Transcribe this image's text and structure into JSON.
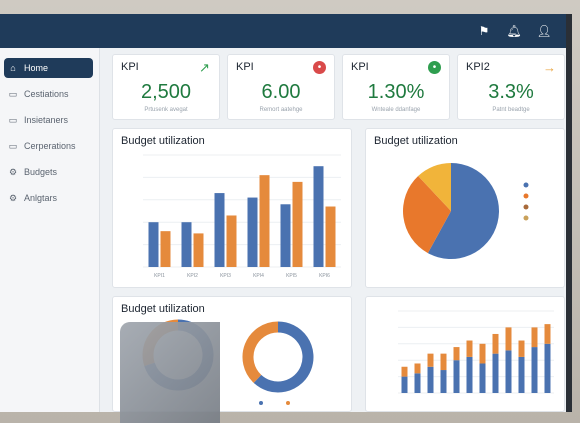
{
  "topbar": {
    "icons": [
      "flag-icon",
      "bell-icon",
      "user-icon"
    ]
  },
  "sidebar": {
    "items": [
      {
        "label": "Home",
        "icon": "home-icon",
        "active": true
      },
      {
        "label": "Cestiations",
        "icon": "doc-icon"
      },
      {
        "label": "Insietaners",
        "icon": "doc-icon"
      },
      {
        "label": "Cerperations",
        "icon": "doc-icon"
      },
      {
        "label": "Budgets",
        "icon": "gear-icon"
      },
      {
        "label": "Anlgtars",
        "icon": "gear-icon"
      }
    ]
  },
  "kpis": [
    {
      "label": "KPI",
      "value": "2,500",
      "sub": "Prtusenk avegat",
      "icon": "arrow-up-icon",
      "icon_color": "#2f9e4f"
    },
    {
      "label": "KPI",
      "value": "6.00",
      "sub": "Remort aatehge",
      "icon": "dot-icon",
      "icon_color": "#d94a4a"
    },
    {
      "label": "KPI",
      "value": "1.30%",
      "sub": "Wnteale ddanfage",
      "icon": "dot-icon",
      "icon_color": "#2f9e4f"
    },
    {
      "label": "KPI2",
      "value": "3.3%",
      "sub": "Patnt beadtge",
      "icon": "arrow-right-icon",
      "icon_color": "#e8a23a"
    }
  ],
  "budget_bar": {
    "title": "Budget utilization",
    "chart_data": {
      "type": "bar",
      "categories": [
        "KPI1",
        "KPI2",
        "KPI3",
        "KPI4",
        "KPI5",
        "KPI6"
      ],
      "series": [
        {
          "color": "#4a72b0",
          "values": [
            2.0,
            2.0,
            3.3,
            3.1,
            2.8,
            4.5
          ]
        },
        {
          "color": "#e58a3c",
          "values": [
            1.6,
            1.5,
            2.3,
            4.1,
            3.8,
            2.7
          ]
        }
      ],
      "ylim": [
        0,
        5
      ]
    }
  },
  "budget_pie": {
    "title": "Budget utilization",
    "chart_data": {
      "type": "pie",
      "slices": [
        {
          "value": 58,
          "color": "#4a72b0"
        },
        {
          "value": 30,
          "color": "#e8782c"
        },
        {
          "value": 12,
          "color": "#f1b43a"
        }
      ]
    }
  },
  "budget_donuts": {
    "title": "Budget utilization",
    "chart_data": {
      "type": "pie",
      "donuts": [
        {
          "slices": [
            {
              "value": 70,
              "color": "#4a72b0"
            },
            {
              "value": 30,
              "color": "#e58a3c"
            }
          ]
        },
        {
          "slices": [
            {
              "value": 62,
              "color": "#4a72b0"
            },
            {
              "value": 38,
              "color": "#e58a3c"
            }
          ]
        }
      ]
    }
  },
  "stacked_bar": {
    "chart_data": {
      "type": "bar",
      "stacked": true,
      "ylim": [
        0,
        25
      ],
      "series": [
        {
          "color": "#4a72b0",
          "values": [
            5,
            6,
            8,
            7,
            10,
            11,
            9,
            12,
            13,
            11,
            14,
            15
          ]
        },
        {
          "color": "#e58a3c",
          "values": [
            3,
            3,
            4,
            5,
            4,
            5,
            6,
            6,
            7,
            5,
            6,
            6
          ]
        }
      ]
    }
  }
}
